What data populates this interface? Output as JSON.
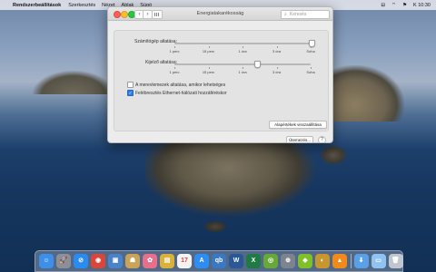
{
  "menubar": {
    "apple": "",
    "app_name": "Rendszerbeállítások",
    "items": [
      "Szerkesztés",
      "Nézet",
      "Ablak",
      "Súgó"
    ],
    "right": {
      "control_center": "⊟",
      "wifi": "⌔",
      "flag": "⚑",
      "clock": "K 10:30"
    }
  },
  "window": {
    "title": "Energiatakarékosság",
    "search": {
      "placeholder": "Keresés",
      "value": ""
    },
    "computer_sleep": {
      "label": "Számítógép altatása:",
      "ticks": [
        "1 perc",
        "15 perc",
        "1 óra",
        "3 óra",
        "Soha"
      ],
      "value_fraction": 1.0
    },
    "display_sleep": {
      "label": "Kijelző altatása:",
      "ticks": [
        "1 perc",
        "15 perc",
        "1 óra",
        "3 óra",
        "Soha"
      ],
      "value_fraction": 0.6
    },
    "options": [
      {
        "label": "A merevlemezek altatása, amikor lehetséges",
        "checked": false
      },
      {
        "label": "Felébresztés Ethernet-hálózati hozzáféréskor",
        "checked": true
      }
    ],
    "restore_defaults": "Alapértékek visszaállítása",
    "schedule": "Ütemezés...",
    "help": "?"
  },
  "dock": {
    "items": [
      {
        "name": "finder",
        "glyph": "☺",
        "color": "#3d8fe8"
      },
      {
        "name": "launchpad",
        "glyph": "🚀",
        "color": "#8a8f98"
      },
      {
        "name": "safari",
        "glyph": "⊘",
        "color": "#2a8cf0"
      },
      {
        "name": "chrome",
        "glyph": "◉",
        "color": "#d9463b"
      },
      {
        "name": "preview",
        "glyph": "▣",
        "color": "#4a83c9"
      },
      {
        "name": "contacts",
        "glyph": "☗",
        "color": "#c9a35a"
      },
      {
        "name": "photos",
        "glyph": "✿",
        "color": "#e76f8c"
      },
      {
        "name": "notes",
        "glyph": "▤",
        "color": "#d8b23c"
      },
      {
        "name": "calendar",
        "glyph": "17",
        "color": "#f4f4f4"
      },
      {
        "name": "app-store",
        "glyph": "A",
        "color": "#2d8df2"
      },
      {
        "name": "qbittorrent",
        "glyph": "qb",
        "color": "#3a78c4"
      },
      {
        "name": "word",
        "glyph": "W",
        "color": "#2b5797"
      },
      {
        "name": "excel",
        "glyph": "X",
        "color": "#1f7a44"
      },
      {
        "name": "mindnode",
        "glyph": "◎",
        "color": "#67a83b"
      },
      {
        "name": "disk-utility",
        "glyph": "⊕",
        "color": "#7d8490"
      },
      {
        "name": "cube-app",
        "glyph": "◆",
        "color": "#7fbf2a"
      },
      {
        "name": "scrobbler",
        "glyph": "◐",
        "color": "#c7962f"
      },
      {
        "name": "vlc",
        "glyph": "▲",
        "color": "#f08a1c"
      },
      {
        "name": "downloads",
        "glyph": "⬇",
        "color": "#5aa0e6"
      },
      {
        "name": "folder",
        "glyph": "▭",
        "color": "#8fc3f2"
      },
      {
        "name": "trash",
        "glyph": "🗑",
        "color": "#c0c6cf"
      }
    ]
  }
}
